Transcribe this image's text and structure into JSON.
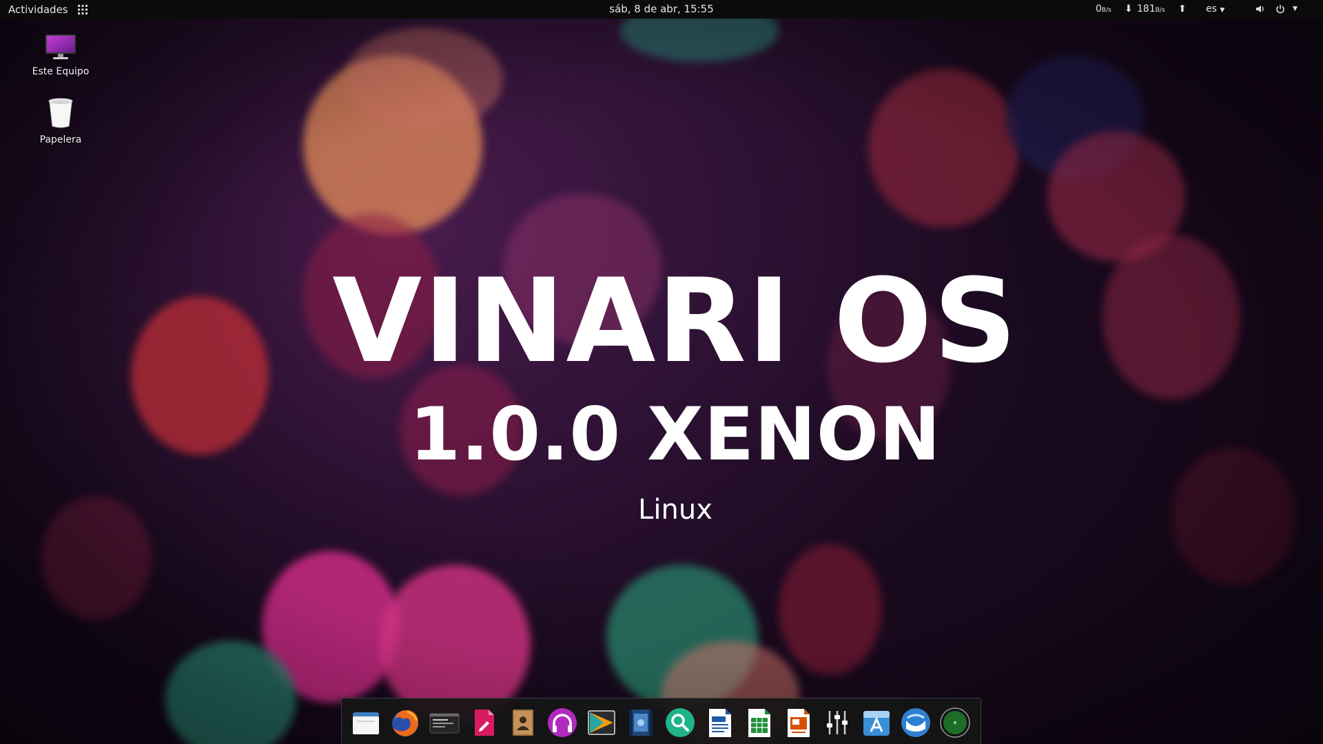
{
  "top_bar": {
    "activities_label": "Actividades",
    "apps_grid_icon": "apps-grid-icon",
    "clock": "sáb,  8 de abr, 15:55",
    "network_down_value": "0",
    "network_down_unit": "B/s",
    "network_up_value": "181",
    "network_up_unit": "B/s",
    "keyboard_layout": "es",
    "volume_icon": "volume-icon",
    "power_icon": "power-icon"
  },
  "desktop_icons": [
    {
      "label": "Este Equipo",
      "icon": "computer-icon"
    },
    {
      "label": "Papelera",
      "icon": "trash-icon"
    }
  ],
  "branding": {
    "title": "VINARI OS",
    "version": "1.0.0 XENON",
    "subtitle": "Linux"
  },
  "dock": {
    "apps": [
      {
        "icon": "files-icon"
      },
      {
        "icon": "firefox-icon"
      },
      {
        "icon": "terminal-icon"
      },
      {
        "icon": "text-editor-icon"
      },
      {
        "icon": "contacts-icon"
      },
      {
        "icon": "music-player-icon"
      },
      {
        "icon": "media-player-icon"
      },
      {
        "icon": "video-editor-icon"
      },
      {
        "icon": "search-icon"
      },
      {
        "icon": "writer-icon"
      },
      {
        "icon": "calc-icon"
      },
      {
        "icon": "impress-icon"
      },
      {
        "icon": "settings-mixer-icon"
      },
      {
        "icon": "software-store-icon"
      },
      {
        "icon": "mail-icon"
      },
      {
        "icon": "globe-icon"
      }
    ]
  },
  "colors": {
    "top_bar_bg": "#0b0b0b",
    "dock_bg": "#161616",
    "wallpaper_base": "#2e1234",
    "text": "#ffffff"
  }
}
